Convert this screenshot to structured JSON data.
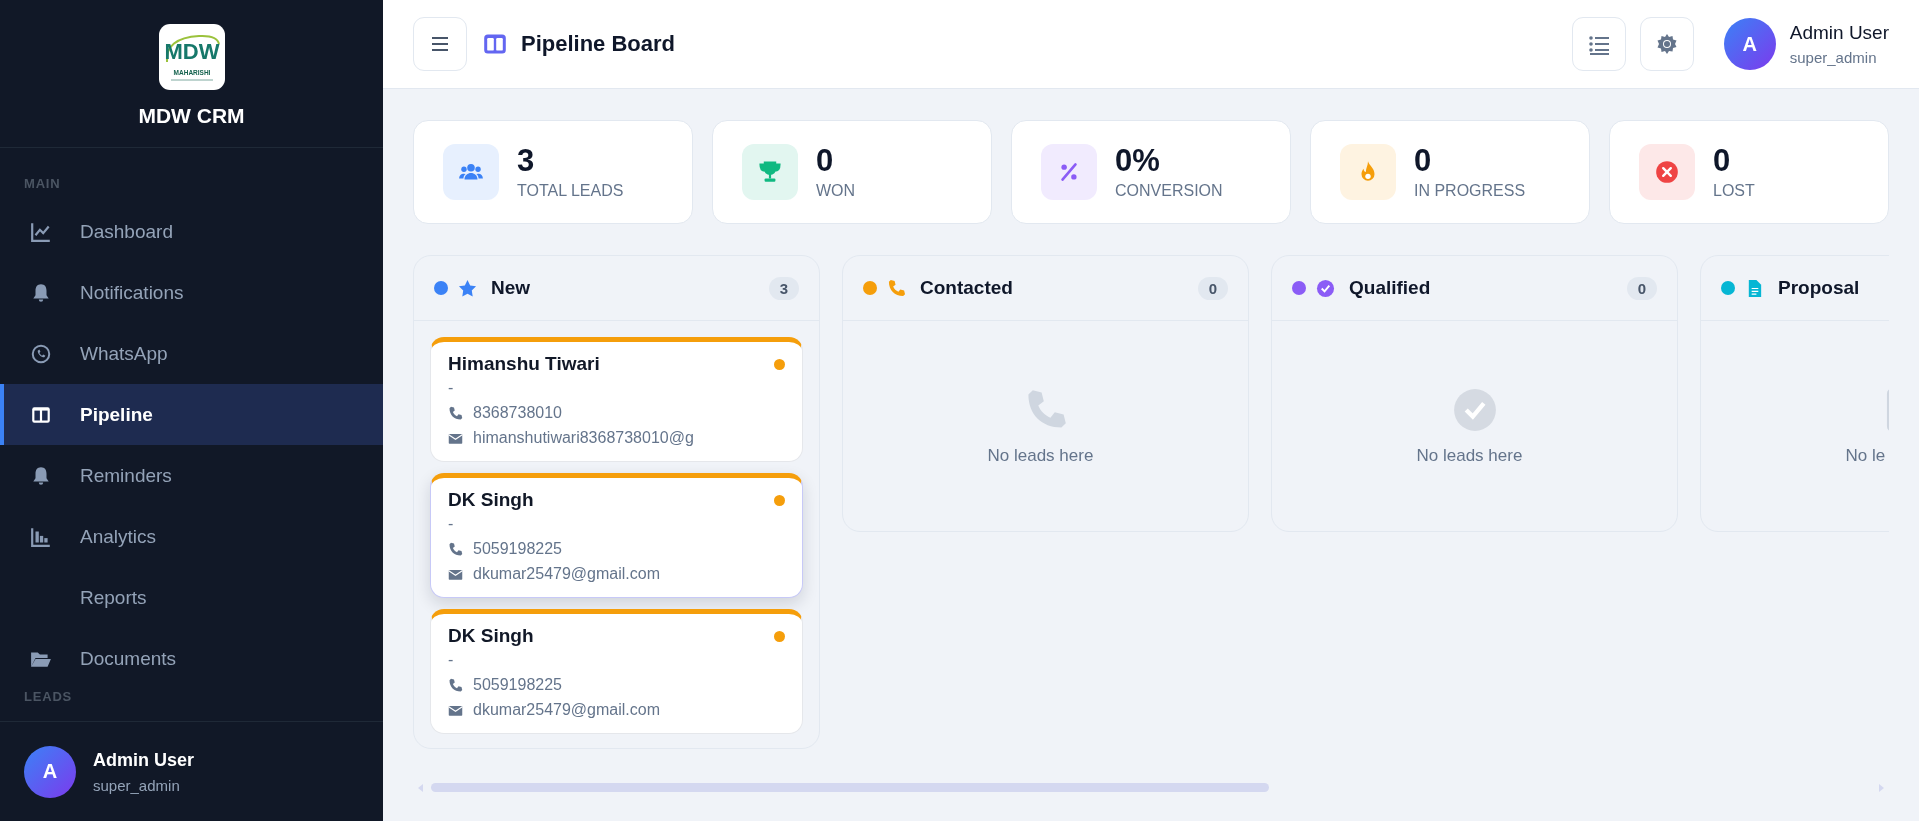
{
  "sidebar": {
    "logo": {
      "mark": "MDW",
      "caption": "MAHARISHI"
    },
    "brand": "MDW CRM",
    "sections": [
      {
        "label": "MAIN",
        "items": [
          {
            "label": "Dashboard",
            "kind": "chart",
            "selected": false
          },
          {
            "label": "Notifications",
            "kind": "bell",
            "selected": false
          },
          {
            "label": "WhatsApp",
            "kind": "chat",
            "selected": false
          },
          {
            "label": "Pipeline",
            "kind": "columns",
            "selected": true
          },
          {
            "label": "Reminders",
            "kind": "bell",
            "selected": false
          },
          {
            "label": "Analytics",
            "kind": "bars",
            "selected": false
          },
          {
            "label": "Reports",
            "kind": "plain",
            "selected": false
          },
          {
            "label": "Documents",
            "kind": "folder",
            "selected": false
          }
        ]
      },
      {
        "label": "LEADS"
      }
    ],
    "user": {
      "initial": "A",
      "name": "Admin User",
      "role": "super_admin"
    }
  },
  "header": {
    "title": "Pipeline Board",
    "user": {
      "initial": "A",
      "name": "Admin User",
      "role": "super_admin"
    }
  },
  "stats": [
    {
      "value": "3",
      "label": "TOTAL LEADS",
      "kind": "users",
      "color": "#3b82f6"
    },
    {
      "value": "0",
      "label": "WON",
      "kind": "trophy",
      "color": "#10b981"
    },
    {
      "value": "0%",
      "label": "CONVERSION",
      "kind": "percent",
      "color": "#8b5cf6"
    },
    {
      "value": "0",
      "label": "IN PROGRESS",
      "kind": "fire",
      "color": "#f59e0b"
    },
    {
      "value": "0",
      "label": "LOST",
      "kind": "xcircle",
      "color": "#ef4444"
    }
  ],
  "columns": [
    {
      "title": "New",
      "kind": "star",
      "color": "#3b82f6",
      "count": "3",
      "leads": [
        {
          "name": "Himanshu Tiwari",
          "company": "-",
          "phone": "8368738010",
          "email": "himanshutiwari8368738010@g",
          "color": "#f59e0b",
          "hovered": false
        },
        {
          "name": "DK Singh",
          "company": "-",
          "phone": "5059198225",
          "email": "dkumar25479@gmail.com",
          "color": "#f59e0b",
          "hovered": true
        },
        {
          "name": "DK Singh",
          "company": "-",
          "phone": "5059198225",
          "email": "dkumar25479@gmail.com",
          "color": "#f59e0b",
          "hovered": false
        }
      ]
    },
    {
      "title": "Contacted",
      "kind": "phone",
      "color": "#f59e0b",
      "count": "0",
      "empty_text": "No leads here"
    },
    {
      "title": "Qualified",
      "kind": "check",
      "color": "#8b5cf6",
      "count": "0",
      "empty_text": "No leads here"
    },
    {
      "title": "Proposal",
      "kind": "file",
      "color": "#06b6d4",
      "empty_text": "No le"
    }
  ]
}
